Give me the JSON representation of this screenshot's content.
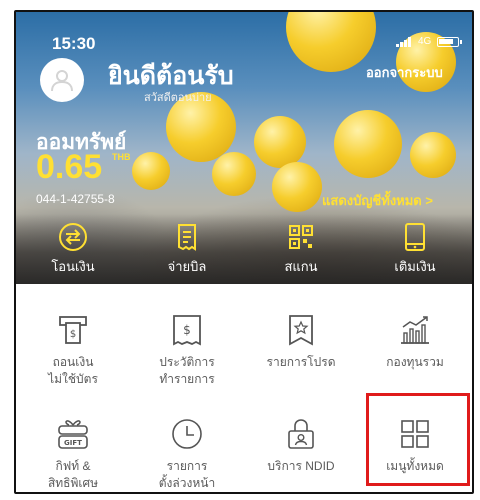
{
  "status_bar": {
    "time": "15:30",
    "network": "4G"
  },
  "header": {
    "welcome": "ยินดีต้อนรับ",
    "subtitle": "สวัสดีตอนบ่าย",
    "logout": "ออกจากระบบ"
  },
  "account": {
    "type": "ออมทรัพย์",
    "balance": "0.65",
    "currency": "THB",
    "number": "044-1-42755-8",
    "show_all": "แสดงบัญชีทั้งหมด >"
  },
  "quick_actions": [
    {
      "label": "โอนเงิน",
      "icon": "transfer-icon"
    },
    {
      "label": "จ่ายบิล",
      "icon": "bill-icon"
    },
    {
      "label": "สแกน",
      "icon": "qr-scan-icon"
    },
    {
      "label": "เติมเงิน",
      "icon": "mobile-topup-icon"
    }
  ],
  "menu": [
    {
      "label": "ถอนเงิน\nไม่ใช้บัตร",
      "icon": "cardless-withdraw-icon"
    },
    {
      "label": "ประวัติการ\nทำรายการ",
      "icon": "transaction-history-icon"
    },
    {
      "label": "รายการโปรด",
      "icon": "favorite-icon"
    },
    {
      "label": "กองทุนรวม",
      "icon": "mutual-fund-icon"
    },
    {
      "label": "กิฟท์ &\nสิทธิพิเศษ",
      "icon": "gift-icon"
    },
    {
      "label": "รายการ\nตั้งล่วงหน้า",
      "icon": "scheduled-icon"
    },
    {
      "label": "บริการ NDID",
      "icon": "ndid-icon"
    },
    {
      "label": "เมนูทั้งหมด",
      "icon": "all-menu-icon"
    }
  ],
  "colors": {
    "accent_yellow": "#ffe033",
    "highlight_red": "#e01b1b",
    "label_gray": "#5a5a5a"
  }
}
